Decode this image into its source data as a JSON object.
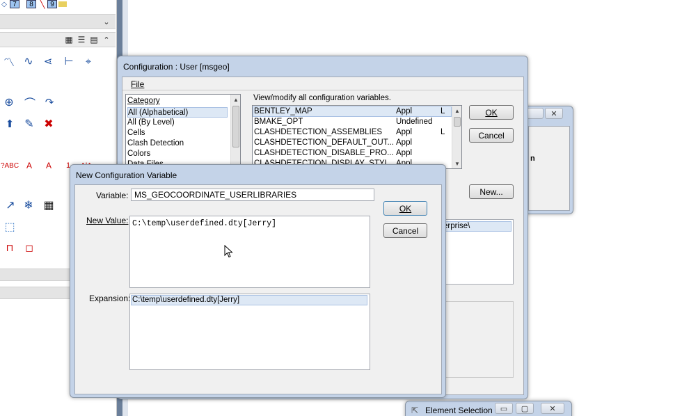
{
  "left_toolbar": {
    "top_icons": [
      "7",
      "8",
      "9"
    ],
    "view_icons": [
      "grid-view-icon",
      "list-view-icon",
      "detail-view-icon",
      "collapse-up-icon"
    ]
  },
  "config_dialog": {
    "title": "Configuration : User [msgeo]",
    "menu_file": "File",
    "category_header": "Category",
    "categories": [
      "All (Alphabetical)",
      "All (By Level)",
      "Cells",
      "Clash Detection",
      "Colors",
      "Data Files"
    ],
    "hint": "View/modify all configuration variables.",
    "variables": [
      {
        "name": "BENTLEY_MAP",
        "level": "Appl",
        "flag": "L"
      },
      {
        "name": "BMAKE_OPT",
        "level": "Undefined",
        "flag": ""
      },
      {
        "name": "CLASHDETECTION_ASSEMBLIES",
        "level": "Appl",
        "flag": "L"
      },
      {
        "name": "CLASHDETECTION_DEFAULT_OUT...",
        "level": "Appl",
        "flag": ""
      },
      {
        "name": "CLASHDETECTION_DISABLE_PRO...",
        "level": "Appl",
        "flag": ""
      },
      {
        "name": "CLASHDETECTION_DISPLAY_STYL...",
        "level": "Appl",
        "flag": ""
      }
    ],
    "ok_label": "OK",
    "cancel_label": "Cancel",
    "new_label": "New...",
    "path_fragment": "erprise\\"
  },
  "new_var_dialog": {
    "title": "New Configuration Variable",
    "variable_label": "Variable:",
    "variable_value": "MS_GEOCOORDINATE_USERLIBRARIES",
    "new_value_label": "New Value:",
    "new_value": "C:\\temp\\userdefined.dty[Jerry]",
    "expansion_label": "Expansion:",
    "expansion_value": "C:\\temp\\userdefined.dty[Jerry]",
    "ok_label": "OK",
    "cancel_label": "Cancel"
  },
  "element_selection": {
    "title": "Element Selection"
  },
  "bg_window": {
    "fragment": "n"
  }
}
